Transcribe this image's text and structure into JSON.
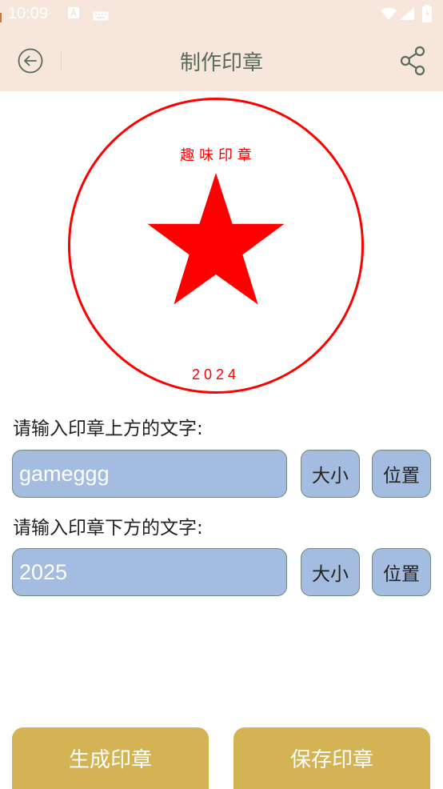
{
  "status_bar": {
    "time": "10:09",
    "icons": [
      "a-logo-icon",
      "keyboard-icon",
      "wifi-icon",
      "signal-icon",
      "battery-icon"
    ]
  },
  "app_bar": {
    "title": "制作印章",
    "back_icon": "back-arrow-circle-icon",
    "share_icon": "share-icon",
    "background": "#f6e6dc",
    "title_color": "#5a6b58"
  },
  "seal": {
    "top_text": "趣 味 印 章",
    "bottom_text": "2024",
    "color": "#ff0000",
    "center_icon": "star-icon"
  },
  "form": {
    "top_label": "请输入印章上方的文字:",
    "top_value": "gameggg",
    "bottom_label": "请输入印章下方的文字:",
    "bottom_value": "2025",
    "size_button": "大小",
    "position_button": "位置"
  },
  "actions": {
    "generate": "生成印章",
    "save": "保存印章",
    "accent": "#d4b354"
  },
  "colors": {
    "input_bg": "#a3bcdf",
    "input_border": "#6d8a7a"
  }
}
